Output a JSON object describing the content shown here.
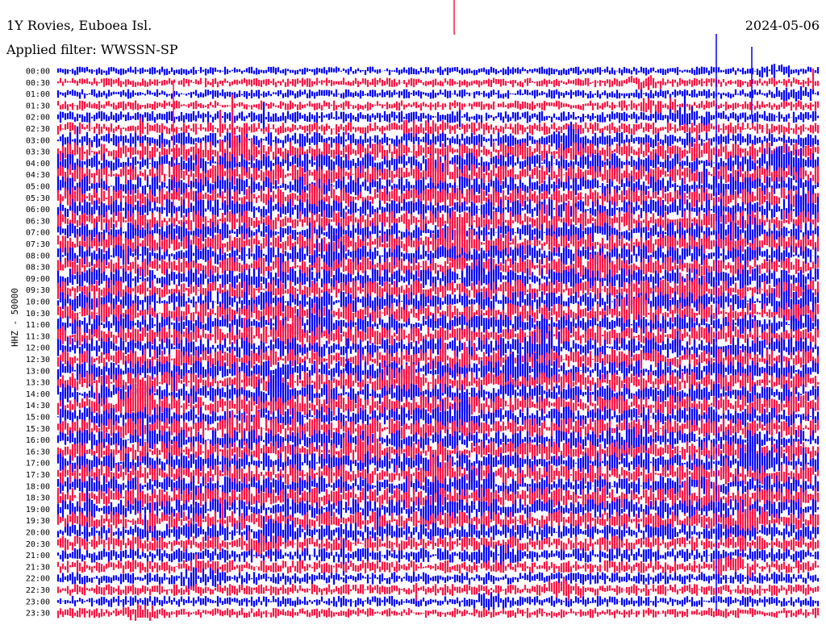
{
  "header": {
    "station": "1Y Rovies, Euboea Isl.",
    "date": "2024-05-06",
    "filter": "Applied filter: WWSSN-SP",
    "channel": "HHZ - 50000"
  },
  "colors": {
    "even_trace": "#0000ff",
    "odd_trace": "#ff1744",
    "background": "#ffffff"
  },
  "chart_data": {
    "type": "line",
    "title": "1Y Rovies, Euboea Isl.",
    "ylabel": "HHZ - 50000",
    "tick_labels": [
      "00:00",
      "00:30",
      "01:00",
      "01:30",
      "02:00",
      "02:30",
      "03:00",
      "03:30",
      "04:00",
      "04:30",
      "05:00",
      "05:30",
      "06:00",
      "06:30",
      "07:00",
      "07:30",
      "08:00",
      "08:30",
      "09:00",
      "09:30",
      "10:00",
      "10:30",
      "11:00",
      "11:30",
      "12:00",
      "12:30",
      "13:00",
      "13:30",
      "14:00",
      "14:30",
      "15:00",
      "15:30",
      "16:00",
      "16:30",
      "17:00",
      "17:30",
      "18:00",
      "18:30",
      "19:00",
      "19:30",
      "20:00",
      "20:30",
      "21:00",
      "21:30",
      "22:00",
      "22:30",
      "23:00",
      "23:30"
    ],
    "series_colors_alternate": [
      "blue",
      "red"
    ],
    "noise_level_by_row": [
      0.25,
      0.3,
      0.3,
      0.35,
      0.45,
      0.5,
      0.7,
      0.9,
      1.0,
      1.0,
      1.0,
      1.0,
      1.0,
      1.0,
      1.0,
      1.0,
      1.0,
      1.0,
      1.0,
      1.0,
      1.0,
      1.0,
      1.0,
      1.0,
      1.0,
      1.0,
      1.0,
      1.0,
      1.0,
      1.0,
      1.0,
      1.0,
      1.0,
      1.0,
      1.0,
      1.0,
      1.0,
      1.0,
      1.0,
      0.9,
      0.8,
      0.7,
      0.6,
      0.55,
      0.5,
      0.45,
      0.4,
      0.35
    ]
  }
}
